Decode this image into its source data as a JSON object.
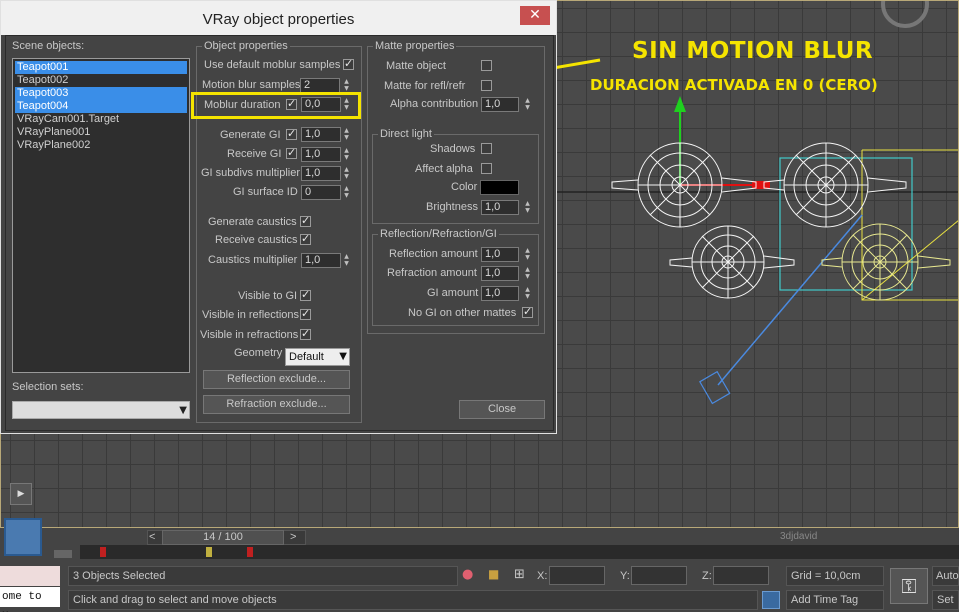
{
  "dialog": {
    "title": "VRay object properties",
    "close_glyph": "✕",
    "scene_objects_label": "Scene objects:",
    "scene_objects": [
      {
        "name": "Teapot001",
        "selected": true
      },
      {
        "name": "Teapot002",
        "selected": false
      },
      {
        "name": "Teapot003",
        "selected": true
      },
      {
        "name": "Teapot004",
        "selected": true
      },
      {
        "name": "VRayCam001.Target",
        "selected": false
      },
      {
        "name": "VRayPlane001",
        "selected": false
      },
      {
        "name": "VRayPlane002",
        "selected": false
      }
    ],
    "selection_sets_label": "Selection sets:",
    "object_properties": {
      "group_label": "Object properties",
      "use_default_moblur": "Use default moblur samples",
      "motion_blur_samples": "Motion blur samples",
      "motion_blur_samples_value": "2",
      "moblur_duration": "Moblur duration",
      "moblur_duration_value": "0,0",
      "generate_gi": "Generate GI",
      "generate_gi_value": "1,0",
      "receive_gi": "Receive GI",
      "receive_gi_value": "1,0",
      "gi_subdivs": "GI subdivs multiplier",
      "gi_subdivs_value": "1,0",
      "gi_surface_id": "GI surface ID",
      "gi_surface_id_value": "0",
      "generate_caustics": "Generate caustics",
      "receive_caustics": "Receive caustics",
      "caustics_multiplier": "Caustics multiplier",
      "caustics_multiplier_value": "1,0",
      "visible_to_gi": "Visible to GI",
      "visible_in_reflections": "Visible in reflections",
      "visible_in_refractions": "Visible in refractions",
      "geometry": "Geometry",
      "geometry_value": "Default",
      "reflection_exclude": "Reflection exclude...",
      "refraction_exclude": "Refraction exclude..."
    },
    "matte_properties": {
      "group_label": "Matte properties",
      "matte_object": "Matte object",
      "matte_for_refl": "Matte for refl/refr",
      "alpha_contribution": "Alpha contribution",
      "alpha_contribution_value": "1,0",
      "direct_light_label": "Direct light",
      "shadows": "Shadows",
      "affect_alpha": "Affect alpha",
      "color": "Color",
      "color_value": "#000000",
      "brightness": "Brightness",
      "brightness_value": "1,0",
      "rrgi_label": "Reflection/Refraction/GI",
      "reflection_amount": "Reflection amount",
      "reflection_amount_value": "1,0",
      "refraction_amount": "Refraction amount",
      "refraction_amount_value": "1,0",
      "gi_amount": "GI amount",
      "gi_amount_value": "1,0",
      "no_gi_other_mattes": "No GI on other mattes"
    },
    "close_label": "Close"
  },
  "annotation": {
    "title": "SIN MOTION BLUR",
    "subtitle": "DURACION ACTIVADA EN 0 (CERO)",
    "color": "#f5e400"
  },
  "timeline": {
    "frame": "14 / 100",
    "prev": "<",
    "next": ">",
    "watermark": "3djdavid"
  },
  "status": {
    "selected": "3 Objects Selected",
    "prompt": "Click and drag to select and move objects",
    "script_text": "ome to M.",
    "x_label": "X:",
    "y_label": "Y:",
    "z_label": "Z:",
    "grid": "Grid = 10,0cm",
    "add_time_tag": "Add Time Tag",
    "auto": "Auto",
    "set": "Set"
  }
}
